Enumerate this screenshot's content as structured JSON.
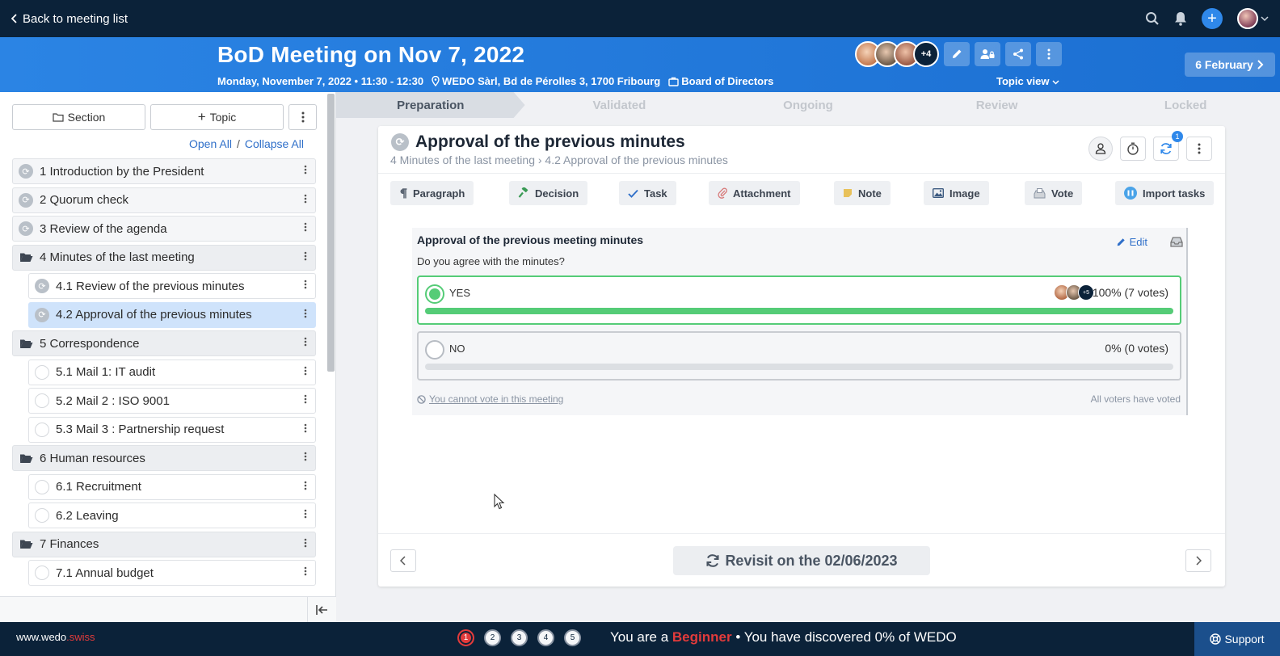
{
  "topbar": {
    "back_label": "Back to meeting list",
    "icons": [
      "search-icon",
      "bell-icon",
      "plus-icon",
      "user-avatar"
    ]
  },
  "header": {
    "title": "BoD Meeting on Nov 7, 2022",
    "date_time": "Monday, November 7, 2022 • 11:30 - 12:30",
    "location": "WEDO Sàrl, Bd de Pérolles 3, 1700 Fribourg",
    "board": "Board of Directors",
    "participants_more": "+4",
    "topic_view_label": "Topic view",
    "next_date_label": "6 February"
  },
  "sidebar": {
    "section_button": "Section",
    "topic_button": "Topic",
    "open_all": "Open All",
    "collapse_all": "Collapse All",
    "link_separator": "/",
    "items": [
      {
        "label": "1 Introduction by the President",
        "kind": "item",
        "icon": "sync"
      },
      {
        "label": "2 Quorum check",
        "kind": "item",
        "icon": "sync"
      },
      {
        "label": "3 Review of the agenda",
        "kind": "item",
        "icon": "sync"
      },
      {
        "label": "4 Minutes of the last meeting",
        "kind": "section",
        "icon": "folder"
      },
      {
        "label": "4.1 Review of the previous minutes",
        "kind": "sub",
        "icon": "sync"
      },
      {
        "label": "4.2 Approval of the previous minutes",
        "kind": "sub-active",
        "icon": "sync"
      },
      {
        "label": "5 Correspondence",
        "kind": "section",
        "icon": "folder"
      },
      {
        "label": "5.1 Mail 1: IT audit",
        "kind": "sub",
        "icon": "empty"
      },
      {
        "label": "5.2 Mail 2 : ISO 9001",
        "kind": "sub",
        "icon": "empty"
      },
      {
        "label": "5.3 Mail 3 : Partnership request",
        "kind": "sub",
        "icon": "empty"
      },
      {
        "label": "6 Human resources",
        "kind": "section",
        "icon": "folder"
      },
      {
        "label": "6.1 Recruitment",
        "kind": "sub",
        "icon": "empty"
      },
      {
        "label": "6.2 Leaving",
        "kind": "sub",
        "icon": "empty"
      },
      {
        "label": "7 Finances",
        "kind": "section",
        "icon": "folder"
      },
      {
        "label": "7.1 Annual budget",
        "kind": "sub",
        "icon": "empty"
      }
    ]
  },
  "steps": [
    "Preparation",
    "Validated",
    "Ongoing",
    "Review",
    "Locked"
  ],
  "topic": {
    "title": "Approval of the previous minutes",
    "breadcrumb": "4 Minutes of the last meeting › 4.2 Approval of the previous minutes",
    "notification_count": "1",
    "insert_buttons": [
      {
        "label": "Paragraph",
        "icon": "paragraph-icon",
        "color": "#5b6573"
      },
      {
        "label": "Decision",
        "icon": "gavel-icon",
        "color": "#3a9a55"
      },
      {
        "label": "Task",
        "icon": "check-icon",
        "color": "#2f6fc9"
      },
      {
        "label": "Attachment",
        "icon": "paperclip-icon",
        "color": "#d77a7a"
      },
      {
        "label": "Note",
        "icon": "note-icon",
        "color": "#e8c15a"
      },
      {
        "label": "Image",
        "icon": "image-icon",
        "color": "#3c5a80"
      },
      {
        "label": "Vote",
        "icon": "ballot-icon",
        "color": "#8a94a3"
      },
      {
        "label": "Import tasks",
        "icon": "import-icon",
        "color": "#4aa3e8"
      }
    ]
  },
  "vote": {
    "title": "Approval of the previous meeting minutes",
    "question": "Do you agree with the minutes?",
    "edit_label": "Edit",
    "options": [
      {
        "label": "YES",
        "result": "100% (7 votes)",
        "fraction": 1.0,
        "voters_more": "+5"
      },
      {
        "label": "NO",
        "result": "0% (0 votes)",
        "fraction": 0.0
      }
    ],
    "cannot_vote": "You cannot vote in this meeting",
    "all_voted": "All voters have voted"
  },
  "footer_nav": {
    "revisit_label": "Revisit on the 02/06/2023"
  },
  "footer": {
    "brand_main": "www.wedo",
    "brand_suffix": ".swiss",
    "dots": [
      "1",
      "2",
      "3",
      "4",
      "5"
    ],
    "level_prefix": "You are a",
    "level_name": "Beginner",
    "level_suffix": "• You have discovered 0% of WEDO",
    "support_label": "Support"
  },
  "colors": {
    "topbar": "#0b2239",
    "header": "#2b84e4",
    "accent": "#2f88ea",
    "vote_green": "#55cc77",
    "beginner_red": "#e23b3b"
  }
}
